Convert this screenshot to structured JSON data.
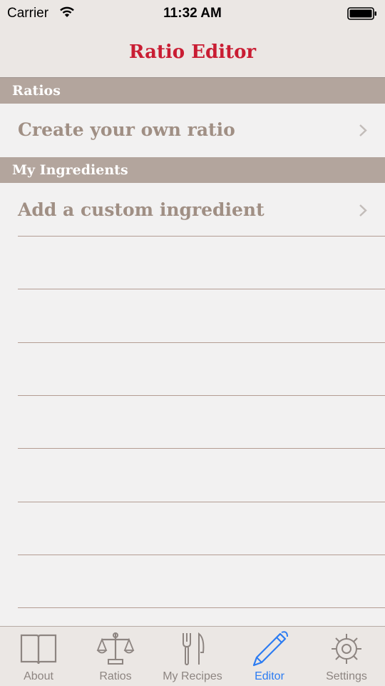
{
  "status_bar": {
    "carrier": "Carrier",
    "time": "11:32 AM"
  },
  "nav": {
    "title": "Ratio Editor"
  },
  "sections": {
    "ratios": {
      "header": "Ratios",
      "row_label": "Create your own ratio"
    },
    "ingredients": {
      "header": "My Ingredients",
      "row_label": "Add a custom ingredient"
    }
  },
  "tabs": {
    "about": "About",
    "ratios": "Ratios",
    "my_recipes": "My Recipes",
    "editor": "Editor",
    "settings": "Settings",
    "active": "Editor"
  },
  "colors": {
    "title": "#c91d33",
    "section_header_bg": "#b3a59d",
    "row_text": "#a08f84",
    "tab_active": "#2c7cf2",
    "tab_inactive": "#8d8581"
  }
}
